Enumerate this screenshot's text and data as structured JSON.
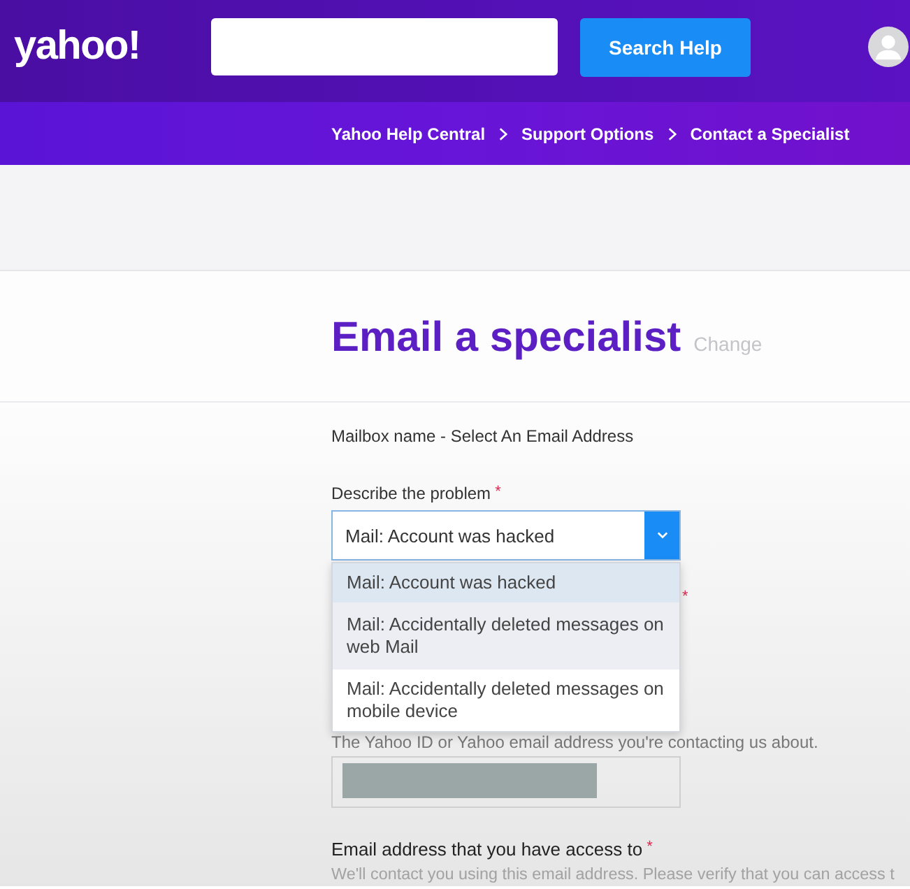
{
  "header": {
    "logo": "yahoo!",
    "search_button": "Search Help"
  },
  "breadcrumbs": [
    {
      "label": "Yahoo Help Central"
    },
    {
      "label": "Support Options"
    },
    {
      "label": "Contact a Specialist"
    }
  ],
  "heading": {
    "title": "Email a specialist",
    "change_link": "Change"
  },
  "form": {
    "mailbox_label": "Mailbox name - Select An Email Address",
    "problem": {
      "label": "Describe the problem",
      "required_mark": "*",
      "value": "Mail: Account was hacked",
      "expanded": true,
      "options": [
        {
          "label": "Mail: Account was hacked",
          "selected": true,
          "highlighted": false
        },
        {
          "label": "Mail: Accidentally deleted messages on web Mail",
          "selected": false,
          "highlighted": true
        },
        {
          "label": "Mail: Accidentally deleted messages on mobile device",
          "selected": false,
          "highlighted": false
        }
      ]
    },
    "account": {
      "required_mark": "*",
      "hint": "The Yahoo ID or Yahoo email address you're contacting us about.",
      "redacted": true
    },
    "contact_email": {
      "label": "Email address that you have access to",
      "required_mark": "*",
      "hint": "We'll contact you using this email address. Please verify that you can access t"
    }
  }
}
